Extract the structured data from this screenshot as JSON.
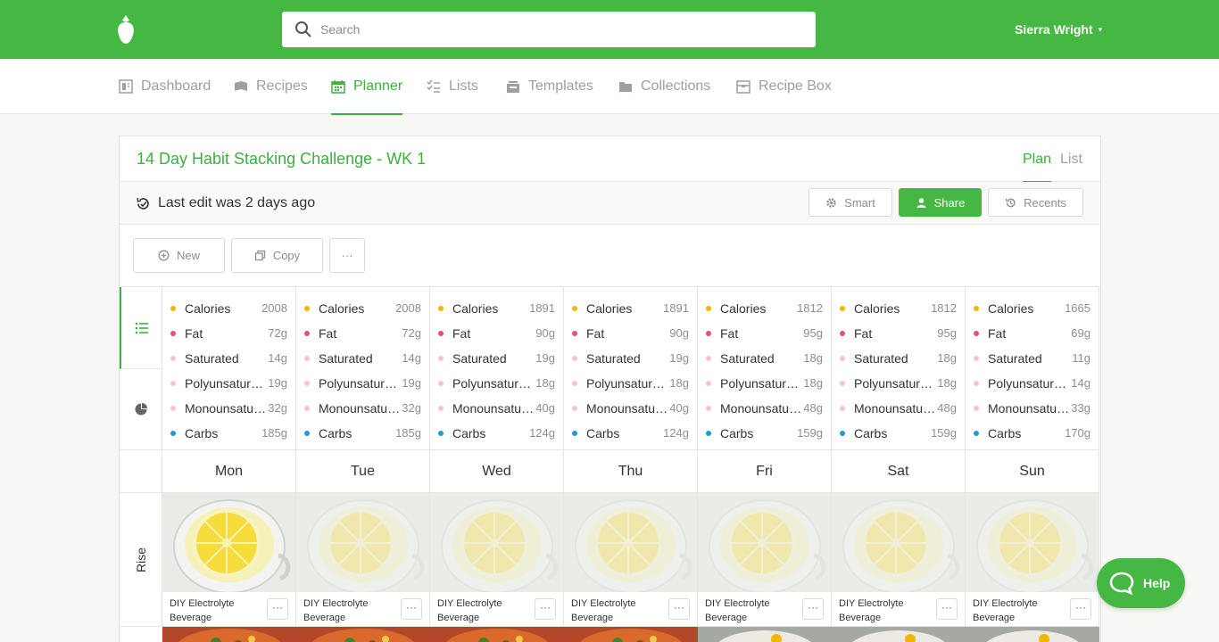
{
  "header": {
    "search_placeholder": "Search",
    "user_name": "Sierra Wright",
    "brand_color": "#44b842"
  },
  "nav": {
    "items": [
      {
        "label": "Dashboard",
        "icon": "dashboard-icon"
      },
      {
        "label": "Recipes",
        "icon": "recipes-icon"
      },
      {
        "label": "Planner",
        "icon": "calendar-icon",
        "active": true
      },
      {
        "label": "Lists",
        "icon": "checklist-icon"
      },
      {
        "label": "Templates",
        "icon": "templates-icon"
      },
      {
        "label": "Collections",
        "icon": "folder-icon"
      },
      {
        "label": "Recipe Box",
        "icon": "recipe-box-icon"
      }
    ]
  },
  "plan": {
    "title": "14 Day Habit Stacking Challenge - WK 1",
    "view_tabs": [
      "Plan",
      "List"
    ],
    "last_edit": "Last edit was 2 days ago",
    "buttons": {
      "smart": "Smart",
      "share": "Share",
      "recents": "Recents",
      "new": "New",
      "copy": "Copy",
      "more": "···"
    }
  },
  "nutrient_colors": {
    "Calories": "#f2b705",
    "Fat": "#e8506b",
    "Saturated": "#f6c4cf",
    "Polyunsaturated": "#f6c4cf",
    "Monounsaturated": "#f6c4cf",
    "Carbs": "#1e9bd7"
  },
  "days": [
    {
      "name": "Mon",
      "nutrients": {
        "calories": "2008",
        "fat": "72g",
        "saturated": "14g",
        "poly": "19g",
        "mono": "32g",
        "carbs": "185g"
      }
    },
    {
      "name": "Tue",
      "nutrients": {
        "calories": "2008",
        "fat": "72g",
        "saturated": "14g",
        "poly": "19g",
        "mono": "32g",
        "carbs": "185g"
      }
    },
    {
      "name": "Wed",
      "nutrients": {
        "calories": "1891",
        "fat": "90g",
        "saturated": "19g",
        "poly": "18g",
        "mono": "40g",
        "carbs": "124g"
      }
    },
    {
      "name": "Thu",
      "nutrients": {
        "calories": "1891",
        "fat": "90g",
        "saturated": "19g",
        "poly": "18g",
        "mono": "40g",
        "carbs": "124g"
      }
    },
    {
      "name": "Fri",
      "nutrients": {
        "calories": "1812",
        "fat": "95g",
        "saturated": "18g",
        "poly": "18g",
        "mono": "48g",
        "carbs": "159g"
      }
    },
    {
      "name": "Sat",
      "nutrients": {
        "calories": "1812",
        "fat": "95g",
        "saturated": "18g",
        "poly": "18g",
        "mono": "48g",
        "carbs": "159g"
      }
    },
    {
      "name": "Sun",
      "nutrients": {
        "calories": "1665",
        "fat": "69g",
        "saturated": "11g",
        "poly": "14g",
        "mono": "33g",
        "carbs": "170g"
      }
    }
  ],
  "nutrient_labels": {
    "calories": "Calories",
    "fat": "Fat",
    "saturated": "Saturated",
    "poly": "Polyunsaturated",
    "mono": "Monounsaturated",
    "carbs": "Carbs"
  },
  "meals": {
    "rise_label": "Rise",
    "rise_recipe": "DIY Electrolyte Beverage"
  },
  "help": {
    "label": "Help"
  }
}
